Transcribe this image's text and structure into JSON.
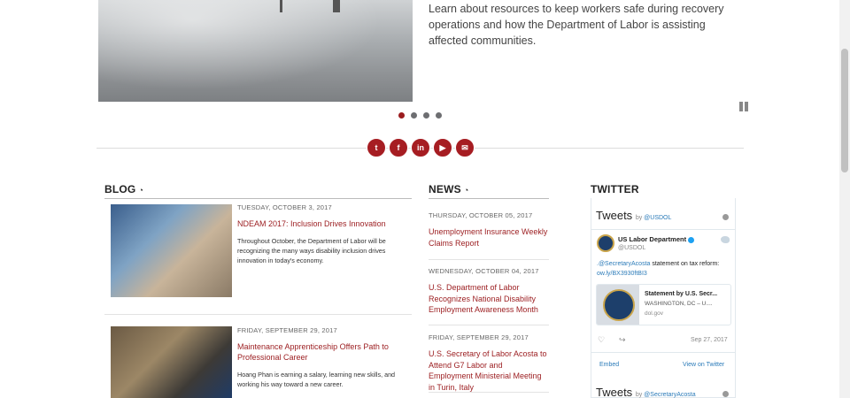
{
  "hero": {
    "description": "Learn about resources to keep workers safe during recovery operations and how the Department of Labor is assisting affected communities.",
    "slides": 4,
    "active_slide": 1
  },
  "social": [
    {
      "icon": "twitter-icon",
      "glyph": "t"
    },
    {
      "icon": "facebook-icon",
      "glyph": "f"
    },
    {
      "icon": "linkedin-icon",
      "glyph": "in"
    },
    {
      "icon": "youtube-icon",
      "glyph": "▶"
    },
    {
      "icon": "email-icon",
      "glyph": "✉"
    }
  ],
  "blog": {
    "heading": "BLOG",
    "items": [
      {
        "date": "TUESDAY, OCTOBER 3, 2017",
        "title": "NDEAM 2017: Inclusion Drives Innovation",
        "desc": "Throughout October, the Department of Labor will be recognizing the many ways disability inclusion drives innovation in today's economy."
      },
      {
        "date": "FRIDAY, SEPTEMBER 29, 2017",
        "title": "Maintenance Apprenticeship Offers Path to Professional Career",
        "desc": "Hoang Phan is earning a salary, learning new skills, and working his way toward a new career."
      }
    ]
  },
  "news": {
    "heading": "NEWS",
    "items": [
      {
        "date": "THURSDAY, OCTOBER 05, 2017",
        "title": "Unemployment Insurance Weekly Claims Report"
      },
      {
        "date": "WEDNESDAY, OCTOBER 04, 2017",
        "title": "U.S. Department of Labor Recognizes National Disability Employment Awareness Month"
      },
      {
        "date": "FRIDAY, SEPTEMBER 29, 2017",
        "title": "U.S. Secretary of Labor Acosta to Attend G7 Labor and Employment Ministerial Meeting in Turin, Italy"
      }
    ]
  },
  "twitter": {
    "heading": "TWITTER",
    "tweets_label": "Tweets",
    "by": "by",
    "handle": "@USDOL",
    "account_name": "US Labor Department",
    "account_handle": "@USDOL",
    "tweet_mention": ".@SecretaryAcosta",
    "tweet_text": " statement on tax reform:",
    "tweet_link": "ow.ly/BX3930ftBI3",
    "card_title": "Statement by U.S. Secr...",
    "card_desc": "WASHINGTON, DC – U....",
    "card_domain": "dol.gov",
    "tweet_date": "Sep 27, 2017",
    "embed": "Embed",
    "view": "View on Twitter",
    "second_handle": "@SecretaryAcosta"
  }
}
